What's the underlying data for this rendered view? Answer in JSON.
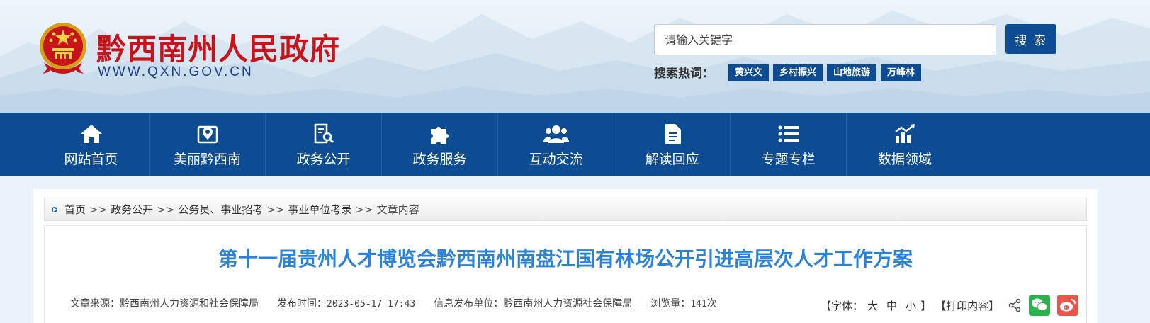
{
  "header": {
    "site_title": "黔西南州人民政府",
    "site_url": "WWW.QXN.GOV.CN",
    "search_placeholder": "请输入关键字",
    "search_button": "搜 索",
    "hot_label": "搜索热词：",
    "hot_tags": [
      "黄兴文",
      "乡村振兴",
      "山地旅游",
      "万峰林"
    ]
  },
  "nav": {
    "items": [
      {
        "label": "网站首页",
        "icon": "home-icon"
      },
      {
        "label": "美丽黔西南",
        "icon": "map-pin-icon"
      },
      {
        "label": "政务公开",
        "icon": "document-search-icon"
      },
      {
        "label": "政务服务",
        "icon": "puzzle-icon"
      },
      {
        "label": "互动交流",
        "icon": "users-icon"
      },
      {
        "label": "解读回应",
        "icon": "file-icon"
      },
      {
        "label": "专题专栏",
        "icon": "list-icon"
      },
      {
        "label": "数据领域",
        "icon": "chart-icon"
      }
    ]
  },
  "breadcrumb": {
    "items": [
      "首页",
      "政务公开",
      "公务员、事业招考",
      "事业单位考录",
      "文章内容"
    ],
    "separator": ">>"
  },
  "article": {
    "title": "第十一届贵州人才博览会黔西南州南盘江国有林场公开引进高层次人才工作方案",
    "source": "文章来源：黔西南州人力资源和社会保障局",
    "publish_time_label": "发布时间：",
    "publish_time": "2023-05-17 17:43",
    "publisher": "信息发布单位：黔西南州人力资源社会保障局",
    "views_label": "浏览量：",
    "views": "141",
    "views_unit": "次"
  },
  "tools": {
    "font_label": "【字体：",
    "font_large": "大",
    "font_medium": "中",
    "font_small": "小",
    "font_close": "】",
    "print": "【打印内容】"
  },
  "colors": {
    "nav_bg": "#0d4c92",
    "title_red": "#c8141b",
    "article_title": "#2a82d9",
    "wechat": "#2bb24c",
    "weibo": "#e6574d"
  }
}
